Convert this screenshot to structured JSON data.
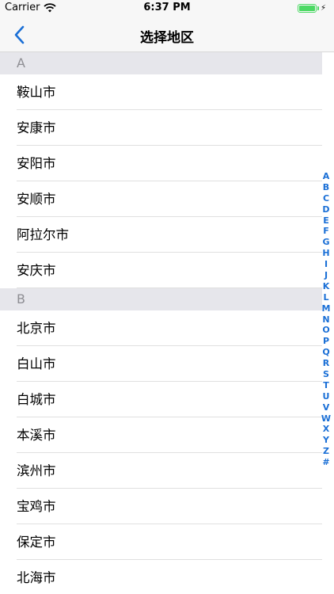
{
  "status": {
    "carrier": "Carrier",
    "time": "6:37 PM",
    "battery_level": 1.0
  },
  "nav": {
    "title": "选择地区",
    "back_icon": "chevron-left-icon"
  },
  "sections": [
    {
      "letter": "A",
      "cities": [
        "鞍山市",
        "安康市",
        "安阳市",
        "安顺市",
        "阿拉尔市",
        "安庆市"
      ]
    },
    {
      "letter": "B",
      "cities": [
        "北京市",
        "白山市",
        "白城市",
        "本溪市",
        "滨州市",
        "宝鸡市",
        "保定市",
        "北海市"
      ]
    }
  ],
  "index": [
    "A",
    "B",
    "C",
    "D",
    "E",
    "F",
    "G",
    "H",
    "I",
    "J",
    "K",
    "L",
    "M",
    "N",
    "O",
    "P",
    "Q",
    "R",
    "S",
    "T",
    "U",
    "V",
    "W",
    "X",
    "Y",
    "Z",
    "#"
  ],
  "colors": {
    "accent": "#1a6fd6",
    "battery": "#4cd964",
    "section_bg": "#e6e6eb"
  }
}
